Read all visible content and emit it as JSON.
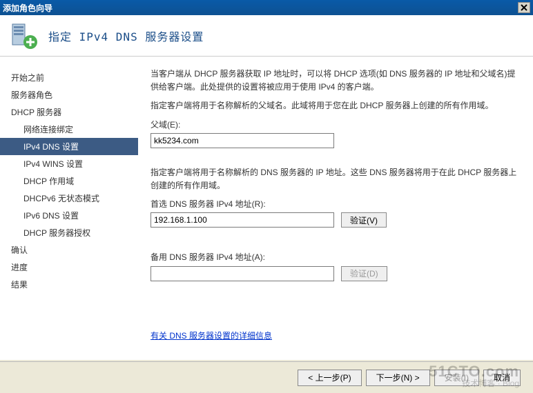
{
  "window": {
    "title": "添加角色向导"
  },
  "header": {
    "title": "指定 IPv4 DNS 服务器设置"
  },
  "sidebar": {
    "items": [
      {
        "label": "开始之前"
      },
      {
        "label": "服务器角色"
      },
      {
        "label": "DHCP 服务器"
      },
      {
        "label": "网络连接绑定"
      },
      {
        "label": "IPv4 DNS 设置"
      },
      {
        "label": "IPv4 WINS 设置"
      },
      {
        "label": "DHCP 作用域"
      },
      {
        "label": "DHCPv6 无状态模式"
      },
      {
        "label": "IPv6 DNS 设置"
      },
      {
        "label": "DHCP 服务器授权"
      },
      {
        "label": "确认"
      },
      {
        "label": "进度"
      },
      {
        "label": "结果"
      }
    ]
  },
  "main": {
    "intro1": "当客户端从 DHCP 服务器获取 IP 地址时，可以将 DHCP 选项(如 DNS 服务器的 IP 地址和父域名)提供给客户端。此处提供的设置将被应用于使用 IPv4 的客户端。",
    "intro2": "指定客户端将用于名称解析的父域名。此域将用于您在此 DHCP 服务器上创建的所有作用域。",
    "parent_domain_label": "父域(E):",
    "parent_domain_value": "kk5234.com",
    "dns_desc": "指定客户端将用于名称解析的 DNS 服务器的 IP 地址。这些 DNS 服务器将用于在此 DHCP 服务器上创建的所有作用域。",
    "preferred_label": "首选 DNS 服务器 IPv4 地址(R):",
    "preferred_value": "192.168.1.100",
    "alternate_label": "备用 DNS 服务器 IPv4 地址(A):",
    "alternate_value": "",
    "validate_btn": "验证(V)",
    "validate_btn2": "验证(D)",
    "link": "有关 DNS 服务器设置的详细信息"
  },
  "buttons": {
    "prev": "< 上一步(P)",
    "next": "下一步(N) >",
    "install": "安装(I)",
    "cancel": "取消"
  },
  "watermark": {
    "main": "51CTO.com",
    "sub": "技术博客 · Blog"
  }
}
